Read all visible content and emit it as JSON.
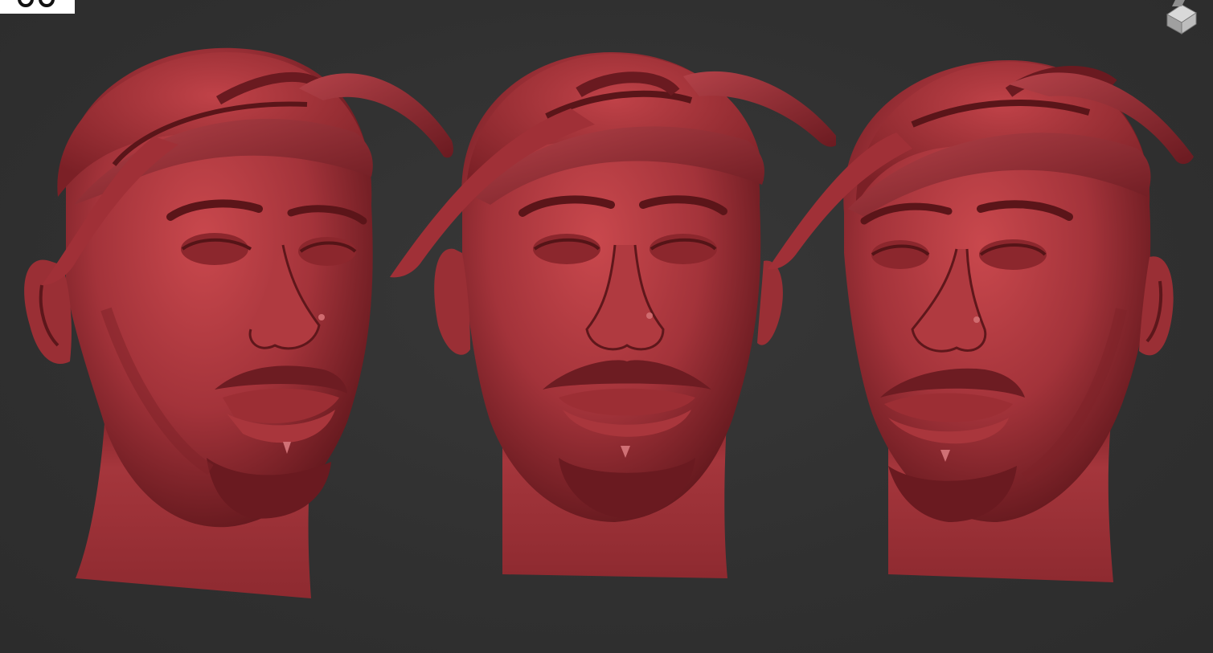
{
  "viewport": {
    "background": "#303030",
    "material_color": "#a8343a",
    "material_shadow": "#5a1418",
    "material_highlight": "#d0585c"
  },
  "navigation": {
    "icon": "navigation-cube-icon"
  },
  "models": [
    {
      "view": "three-quarter-left"
    },
    {
      "view": "front"
    },
    {
      "view": "three-quarter-right"
    }
  ]
}
